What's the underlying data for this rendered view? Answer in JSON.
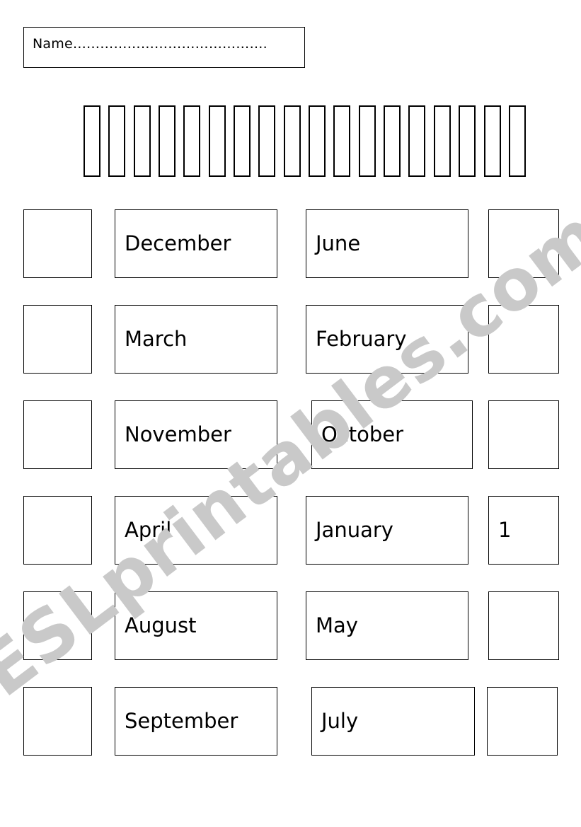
{
  "worksheet": {
    "name_field": {
      "label": "Name",
      "dots": "……………………………………."
    },
    "cut_strips": {
      "count": 18
    },
    "rows": [
      {
        "blank_left": "",
        "word_left": "December",
        "word_right": "June",
        "blank_right": ""
      },
      {
        "blank_left": "",
        "word_left": "March",
        "word_right": "February",
        "blank_right": ""
      },
      {
        "blank_left": "",
        "word_left": "November",
        "word_right": "October",
        "blank_right": ""
      },
      {
        "blank_left": "",
        "word_left": "April",
        "word_right": "January",
        "blank_right": "1"
      },
      {
        "blank_left": "",
        "word_left": "August",
        "word_right": "May",
        "blank_right": ""
      },
      {
        "blank_left": "",
        "word_left": "September",
        "word_right": "July",
        "blank_right": ""
      }
    ]
  },
  "watermark": {
    "text": "ESLprintables.com",
    "color": "#c9c9c9"
  }
}
